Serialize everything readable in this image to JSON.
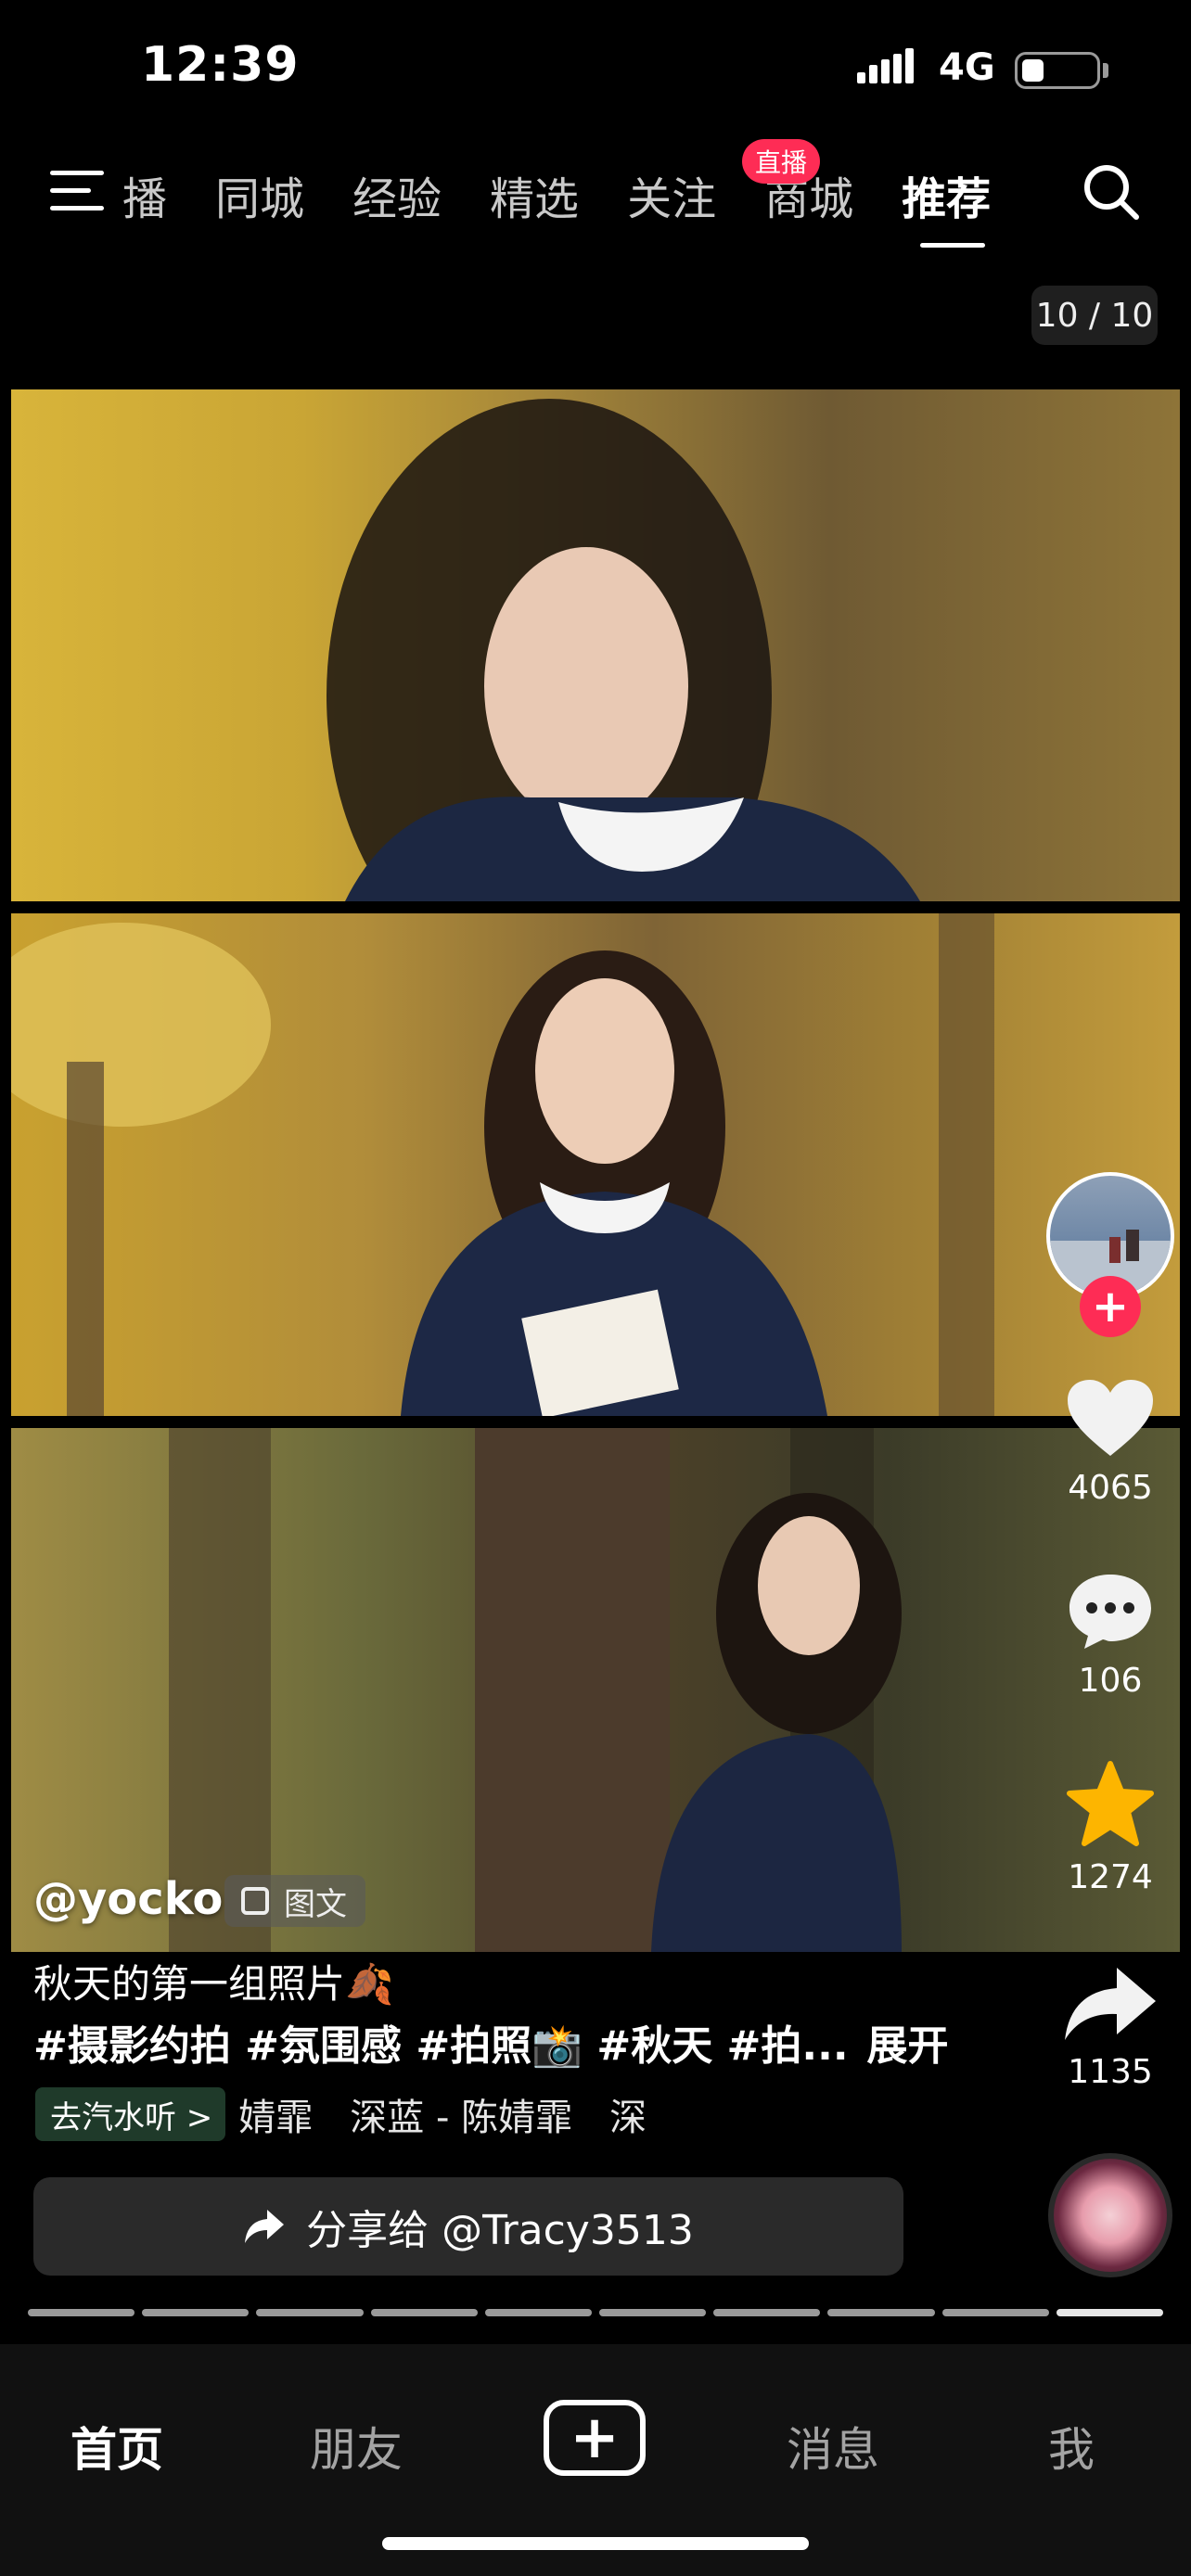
{
  "status": {
    "time": "12:39",
    "network": "4G",
    "battery_level": 0.3
  },
  "nav": {
    "tabs": [
      {
        "label": "播",
        "active": false
      },
      {
        "label": "同城",
        "active": false
      },
      {
        "label": "经验",
        "active": false
      },
      {
        "label": "精选",
        "active": false
      },
      {
        "label": "关注",
        "active": false
      },
      {
        "label": "商城",
        "active": false
      },
      {
        "label": "推荐",
        "active": true
      }
    ],
    "live_badge": "直播"
  },
  "counter": "10 / 10",
  "post": {
    "author": "@yocko",
    "type_badge": "图文",
    "caption": "秋天的第一组照片🍂",
    "tags": "#摄影约拍 #氛围感 #拍照📸 #秋天 #拍...",
    "expand": "展开",
    "music_button": "去汽水听 >",
    "music_text": "婧霏　深蓝 - 陈婧霏　深",
    "share_label": "分享给 @Tracy3513"
  },
  "rail": {
    "likes": "4065",
    "comments": "106",
    "favorites": "1274",
    "shares": "1135"
  },
  "progress": {
    "segments": 10,
    "current": 10
  },
  "bottom_nav": {
    "home": "首页",
    "friends": "朋友",
    "messages": "消息",
    "me": "我"
  },
  "colors": {
    "accent": "#fe2c55",
    "star": "#fdb500"
  }
}
